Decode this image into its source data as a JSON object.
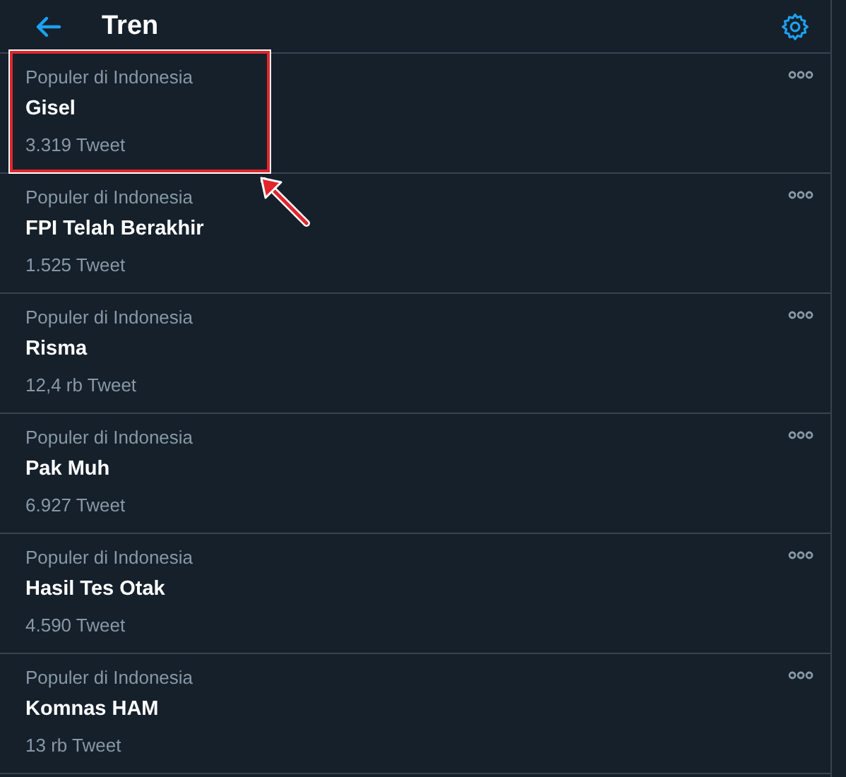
{
  "header": {
    "title": "Tren"
  },
  "trends": [
    {
      "category": "Populer di Indonesia",
      "name": "Gisel",
      "count": "3.319 Tweet",
      "highlighted": true
    },
    {
      "category": "Populer di Indonesia",
      "name": "FPI Telah Berakhir",
      "count": "1.525 Tweet",
      "highlighted": false
    },
    {
      "category": "Populer di Indonesia",
      "name": "Risma",
      "count": "12,4 rb Tweet",
      "highlighted": false
    },
    {
      "category": "Populer di Indonesia",
      "name": "Pak Muh",
      "count": "6.927 Tweet",
      "highlighted": false
    },
    {
      "category": "Populer di Indonesia",
      "name": "Hasil Tes Otak",
      "count": "4.590 Tweet",
      "highlighted": false
    },
    {
      "category": "Populer di Indonesia",
      "name": "Komnas HAM",
      "count": "13 rb Tweet",
      "highlighted": false
    }
  ]
}
